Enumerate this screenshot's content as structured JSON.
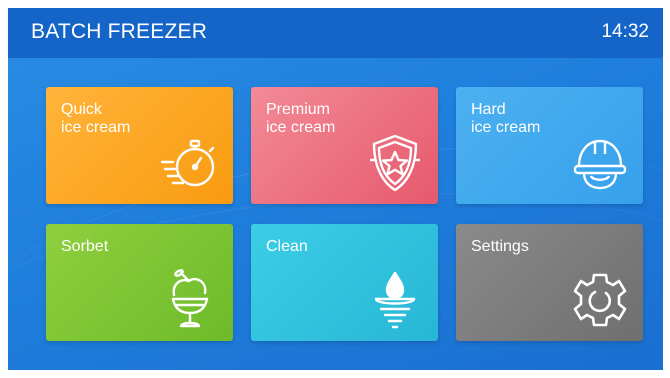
{
  "header": {
    "title": "BATCH FREEZER",
    "time": "14:32"
  },
  "tiles": [
    {
      "label": "Quick\nice cream",
      "icon": "stopwatch-icon",
      "color": "#f9a41f"
    },
    {
      "label": "Premium\nice cream",
      "icon": "shield-star-icon",
      "color": "#ec6c7c"
    },
    {
      "label": "Hard\nice cream",
      "icon": "hard-hat-icon",
      "color": "#3ea7ee"
    },
    {
      "label": "Sorbet",
      "icon": "ice-cream-cup-icon",
      "color": "#7fc535"
    },
    {
      "label": "Clean",
      "icon": "water-drop-icon",
      "color": "#2fc1dd"
    },
    {
      "label": "Settings",
      "icon": "gear-icon",
      "color": "#7d7d7d"
    }
  ],
  "colors": {
    "header_bg": "#1565c9",
    "screen_bg": "#1f7fdc"
  }
}
